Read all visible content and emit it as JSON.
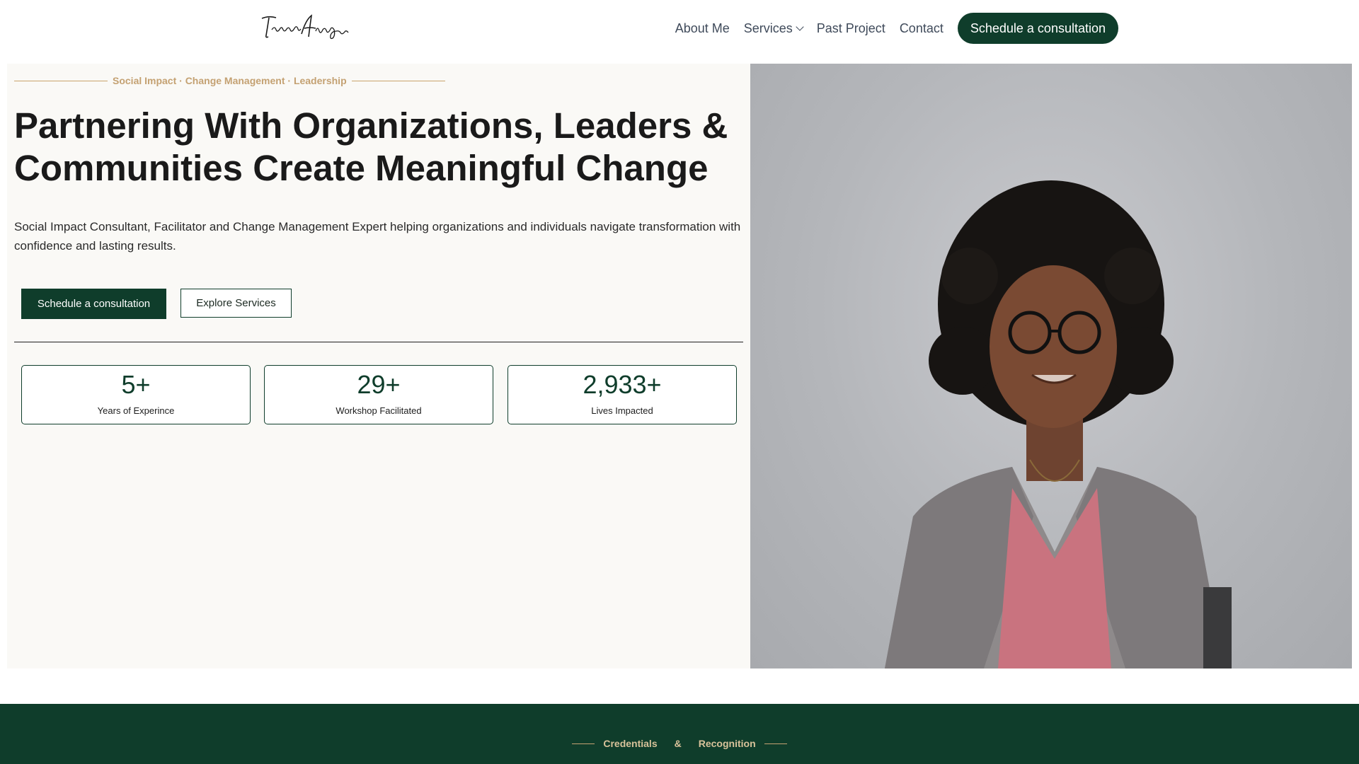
{
  "header": {
    "logo_text": "Temitope Abiagom",
    "nav": [
      {
        "label": "About Me"
      },
      {
        "label": "Services"
      },
      {
        "label": "Past Project"
      },
      {
        "label": "Contact"
      }
    ],
    "cta_label": "Schedule a consultation"
  },
  "hero": {
    "eyebrow": "Social Impact · Change Management · Leadership",
    "headline": "Partnering With Organizations, Leaders & Communities Create Meaningful Change",
    "lead": "Social Impact Consultant, Facilitator and Change Management Expert helping organizations and individuals navigate transformation with confidence and lasting results.",
    "primary_button": "Schedule a consultation",
    "secondary_button": "Explore Services",
    "stats": [
      {
        "value": "5+",
        "label": "Years of Experince"
      },
      {
        "value": "29+",
        "label": "Workshop Facilitated"
      },
      {
        "value": "2,933+",
        "label": "Lives Impacted"
      }
    ]
  },
  "credentials": {
    "eyebrow_left": "Credentials",
    "eyebrow_amp": "&",
    "eyebrow_right": "Recognition"
  },
  "colors": {
    "brand_green": "#0f3d2b",
    "gold": "#c4a172",
    "hero_bg": "#faf9f6"
  }
}
